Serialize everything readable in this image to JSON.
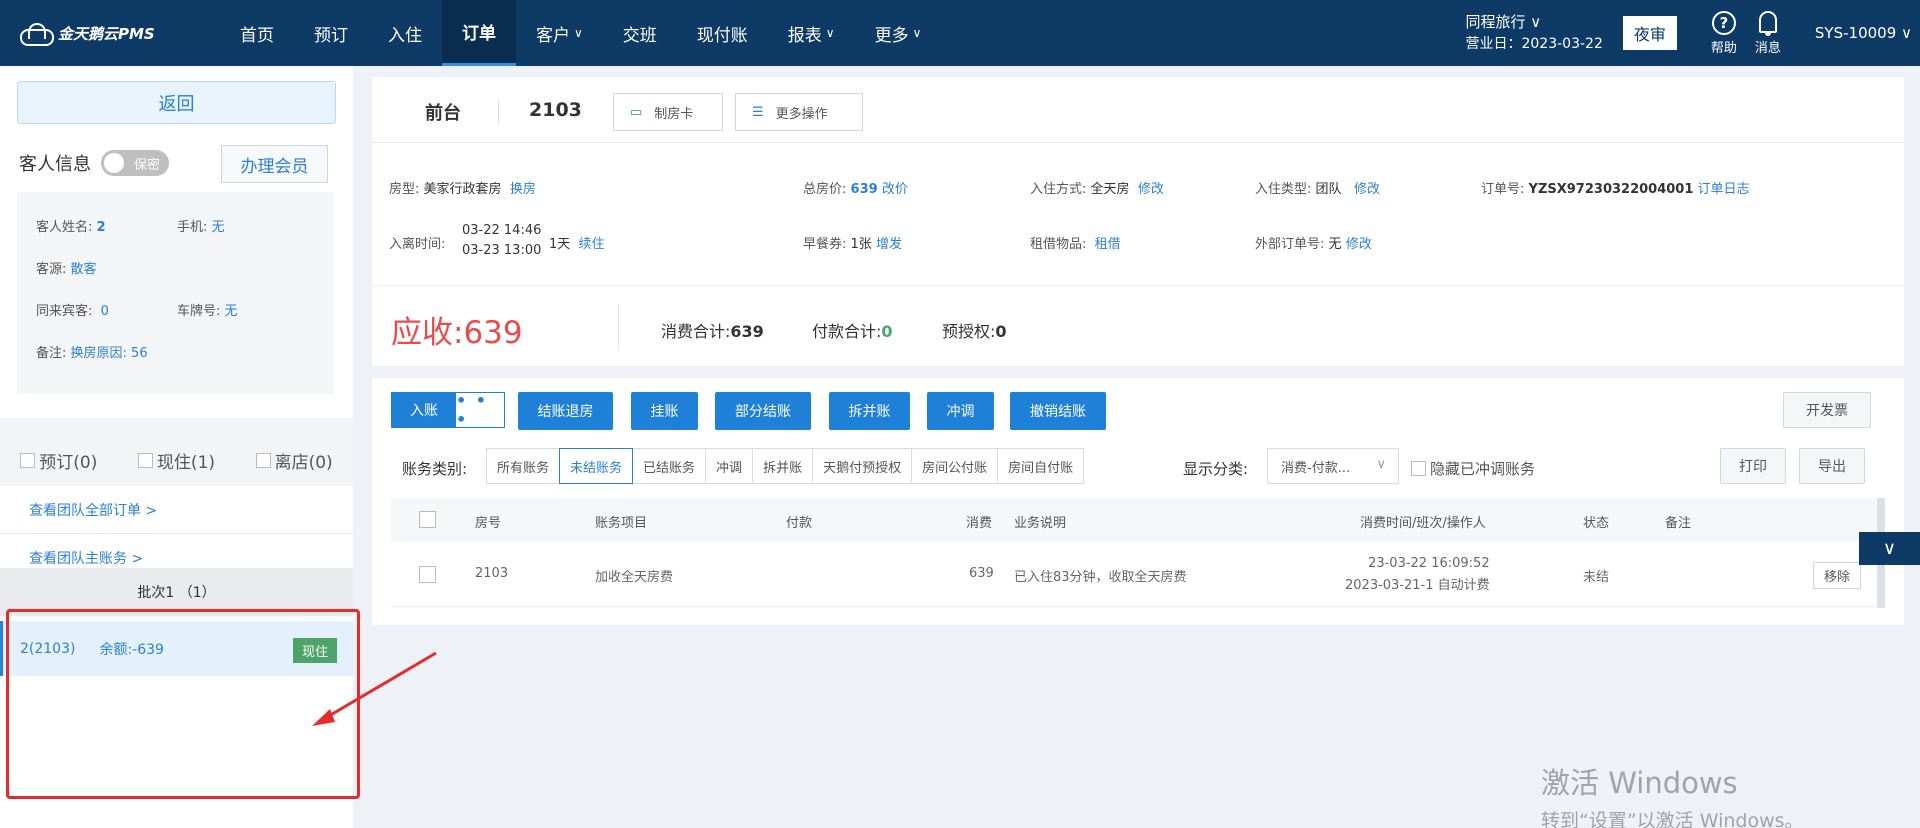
{
  "app": {
    "logo_text": "金天鹅云PMS"
  },
  "nav": {
    "items": [
      {
        "label": "首页",
        "chevron": false
      },
      {
        "label": "预订",
        "chevron": false
      },
      {
        "label": "入住",
        "chevron": false
      },
      {
        "label": "订单",
        "chevron": false,
        "active": true
      },
      {
        "label": "客户",
        "chevron": true
      },
      {
        "label": "交班",
        "chevron": false
      },
      {
        "label": "现付账",
        "chevron": false
      },
      {
        "label": "报表",
        "chevron": true
      },
      {
        "label": "更多",
        "chevron": true
      }
    ],
    "hotel_name": "同程旅行 ∨",
    "business_day": "营业日：2023-03-22",
    "night_audit": "夜审",
    "help": "帮助",
    "messages": "消息",
    "user": "SYS-10009 ∨"
  },
  "left": {
    "back": "返回",
    "guest_info": "客人信息",
    "private_toggle": "保密",
    "member_button": "办理会员",
    "guest": {
      "name_label": "客人姓名:",
      "name_value": "2",
      "phone_label": "手机:",
      "phone_value": "无",
      "source_label": "客源:",
      "source_value": "散客",
      "companions_label": "同来宾客:",
      "companions_value": "0",
      "plate_label": "车牌号:",
      "plate_value": "无",
      "note_label": "备注:",
      "note_value": "换房原因: 56"
    },
    "filters": [
      {
        "label": "预订(0)"
      },
      {
        "label": "现住(1)"
      },
      {
        "label": "离店(0)"
      }
    ],
    "link_all_orders": "查看团队全部订单 >",
    "link_master_account": "查看团队主账务 >",
    "batch": "批次1 （1）",
    "room_entry": {
      "name": "2(2103)",
      "balance": "余额:-639",
      "status": "现住"
    }
  },
  "order": {
    "location": "前台",
    "room": "2103",
    "make_card": "制房卡",
    "more_ops": "更多操作",
    "room_type_label": "房型:",
    "room_type_value": "美家行政套房",
    "change_room": "换房",
    "total_price_label": "总房价:",
    "total_price_value": "639",
    "change_price": "改价",
    "checkin_mode_label": "入住方式:",
    "checkin_mode_value": "全天房",
    "checkin_mode_edit": "修改",
    "checkin_type_label": "入住类型:",
    "checkin_type_value": "团队",
    "checkin_type_edit": "修改",
    "order_no_label": "订单号:",
    "order_no_value": "YZSX97230322004001",
    "order_log": "订单日志",
    "stay_label": "入离时间:",
    "stay_in": "03-22 14:46",
    "stay_out": "03-23 13:00",
    "nights": "1天",
    "extend": "续住",
    "breakfast_label": "早餐券:",
    "breakfast_value": "1张",
    "breakfast_add": "增发",
    "rental_label": "租借物品:",
    "rental_value": "租借",
    "external_label": "外部订单号:",
    "external_value": "无",
    "external_edit": "修改"
  },
  "summary": {
    "due_label": "应收:",
    "due_value": "639",
    "consume_label": "消费合计:",
    "consume_value": "639",
    "payment_label": "付款合计:",
    "payment_value": "0",
    "preauth_label": "预授权:",
    "preauth_value": "0"
  },
  "billing": {
    "post": "入账",
    "post_more": "• • •",
    "actions": [
      "结账退房",
      "挂账",
      "部分结账",
      "拆并账",
      "冲调",
      "撤销结账"
    ],
    "invoice": "开发票",
    "category_label": "账务类别:",
    "categories": [
      {
        "label": "所有账务",
        "active": false
      },
      {
        "label": "未结账务",
        "active": true
      },
      {
        "label": "已结账务",
        "active": false
      },
      {
        "label": "冲调",
        "active": false
      },
      {
        "label": "拆并账",
        "active": false
      },
      {
        "label": "天鹅付预授权",
        "active": false
      },
      {
        "label": "房间公付账",
        "active": false
      },
      {
        "label": "房间自付账",
        "active": false
      }
    ],
    "display_label": "显示分类:",
    "display_value": "消费-付款...",
    "hide_reversed": "隐藏已冲调账务",
    "print": "打印",
    "export": "导出",
    "columns": {
      "room": "房号",
      "item": "账务项目",
      "payment": "付款",
      "consume": "消费",
      "desc": "业务说明",
      "time": "消费时间/班次/操作人",
      "status": "状态",
      "note": "备注"
    },
    "rows": [
      {
        "room": "2103",
        "item": "加收全天房费",
        "payment": "",
        "consume": "639",
        "desc": "已入住83分钟，收取全天房费",
        "time": "23-03-22 16:09:52",
        "shift": "2023-03-21-1 自动计费",
        "status": "未结",
        "note": "",
        "action": "移除"
      }
    ]
  },
  "watermark": {
    "line1": "激活 Windows",
    "line2": "转到“设置”以激活 Windows。"
  },
  "colors": {
    "nav_bg": "#0e3a66",
    "accent": "#1f80d8",
    "due": "#e84c4c",
    "highlight_box": "#e52b2b",
    "status_green": "#4ea36b"
  }
}
